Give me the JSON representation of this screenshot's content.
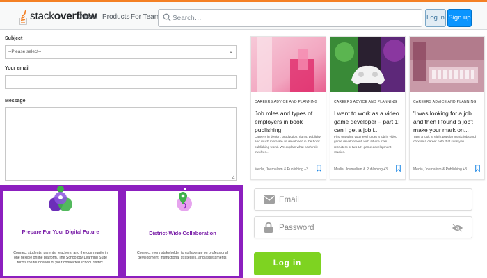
{
  "header": {
    "logo": {
      "text_light": "stack",
      "text_bold": "overflow"
    },
    "nav": [
      {
        "label": "About"
      },
      {
        "label": "Products"
      },
      {
        "label": "For Teams"
      }
    ],
    "search": {
      "placeholder": "Search…",
      "icon": "search-icon"
    },
    "login_label": "Log in",
    "signup_label": "Sign up",
    "colors": {
      "accent": "#f48024",
      "primary_button": "#0a95ff"
    }
  },
  "contact_form": {
    "subject_label": "Subject",
    "subject_value": "--Please select--",
    "email_label": "Your email",
    "message_label": "Message"
  },
  "features": {
    "background": "#8c1fbf",
    "cards": [
      {
        "title": "Prepare For Your Digital Future",
        "text": "Connect students, parents, teachers, and the community in one flexible online platform. The Schoology Learning Suite forms the foundation of your connected school district."
      },
      {
        "title": "District-Wide Collaboration",
        "text": "Connect every stakeholder to collaborate on professional development, instructional strategies, and assessments."
      }
    ]
  },
  "articles": [
    {
      "category": "CAREERS ADVICE AND PLANNING",
      "title": "Job roles and types of employers in book publishing",
      "desc": "Careers in design, production, rights, publicity and much more are all developed in the book publishing world. We explain what each role involves...",
      "tags": "Media, Journalism & Publishing +3",
      "bookmark_icon": "bookmark-icon"
    },
    {
      "category": "CAREERS ADVICE AND PLANNING",
      "title": "I want to work as a video game developer – part 1: can I get a job i...",
      "desc": "Find out what you need to get a job in video game development, with advice from recruiters at two UK game development studios.",
      "tags": "Media, Journalism & Publishing +3",
      "bookmark_icon": "bookmark-icon"
    },
    {
      "category": "CAREERS ADVICE AND PLANNING",
      "title": "'I was looking for a job and then I found a job': make your mark on...",
      "desc": "Take a look at eight popular music jobs and choose a career path that suits you.",
      "tags": "Media, Journalism & Publishing +3",
      "bookmark_icon": "bookmark-icon"
    }
  ],
  "login": {
    "email_placeholder": "Email",
    "password_placeholder": "Password",
    "button_label": "Log in",
    "button_color": "#7ed321",
    "icons": [
      "envelope-icon",
      "lock-icon",
      "eye-off-icon"
    ]
  }
}
